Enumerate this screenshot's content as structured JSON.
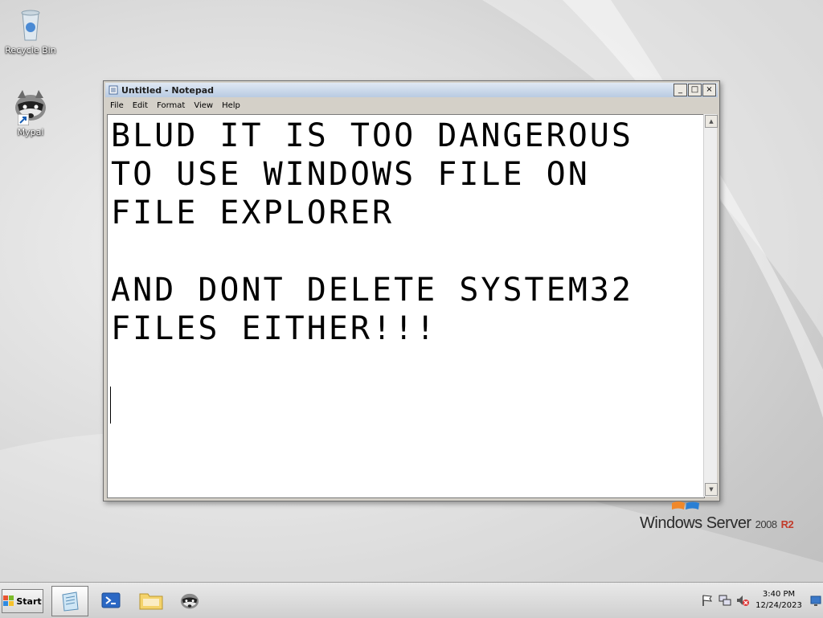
{
  "desktop": {
    "icons": [
      {
        "label": "Recycle Bin",
        "icon": "recycle-bin-icon"
      },
      {
        "label": "Mypal",
        "icon": "raccoon-icon"
      }
    ]
  },
  "notepad": {
    "title": "Untitled - Notepad",
    "menu": [
      "File",
      "Edit",
      "Format",
      "View",
      "Help"
    ],
    "controls": {
      "minimize": "_",
      "maximize": "□",
      "close": "×"
    },
    "text": "BLUD IT IS TOO DANGEROUS\nTO USE WINDOWS FILE ON\nFILE EXPLORER\n\nAND DONT DELETE SYSTEM32\nFILES EITHER!!!"
  },
  "branding": {
    "name": "Windows Server",
    "version": "2008",
    "release": "R2"
  },
  "taskbar": {
    "start_label": "Start",
    "apps": [
      {
        "name": "notepad",
        "icon": "notepad-icon",
        "active": true
      },
      {
        "name": "powershell",
        "icon": "powershell-icon",
        "active": false
      },
      {
        "name": "explorer",
        "icon": "folder-icon",
        "active": false
      },
      {
        "name": "mypal",
        "icon": "raccoon-icon",
        "active": false
      }
    ],
    "tray_icons": [
      "flag-icon",
      "network-icon",
      "volume-muted-icon"
    ],
    "clock": {
      "time": "3:40 PM",
      "date": "12/24/2023"
    }
  },
  "colors": {
    "accent_red": "#c23b2a",
    "title_bar": "#b9cbe2"
  }
}
